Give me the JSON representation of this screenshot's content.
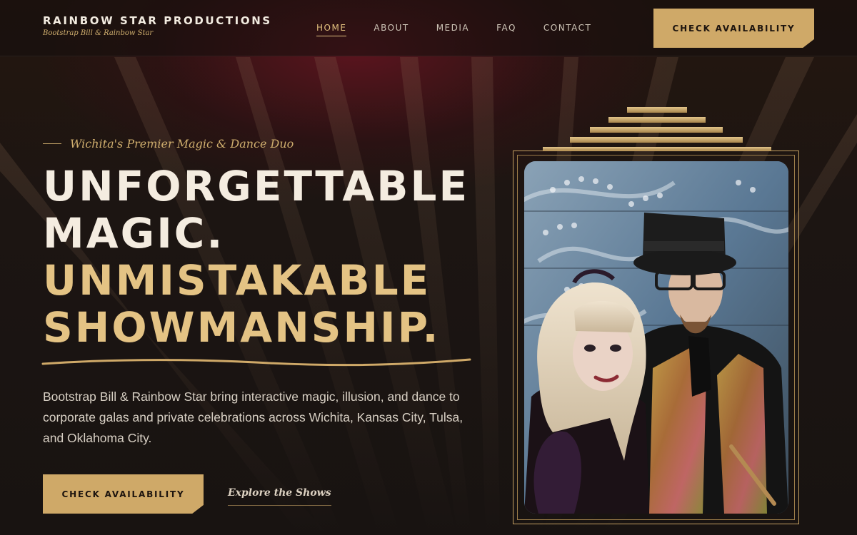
{
  "header": {
    "brand_name": "RAINBOW STAR PRODUCTIONS",
    "brand_subtitle": "Bootstrap Bill & Rainbow Star",
    "nav": [
      {
        "label": "HOME",
        "active": true
      },
      {
        "label": "ABOUT",
        "active": false
      },
      {
        "label": "MEDIA",
        "active": false
      },
      {
        "label": "FAQ",
        "active": false
      },
      {
        "label": "CONTACT",
        "active": false
      }
    ],
    "cta_label": "CHECK AVAILABILITY"
  },
  "hero": {
    "tagline": "Wichita's Premier Magic & Dance Duo",
    "headline_line1": "UNFORGETTABLE",
    "headline_line2": "MAGIC.",
    "headline_line3": "UNMISTAKABLE",
    "headline_line4": "SHOWMANSHIP.",
    "description": "Bootstrap Bill & Rainbow Star bring interactive magic, illusion, and dance to corporate galas and private celebrations across Wichita, Kansas City, Tulsa, and Oklahoma City.",
    "primary_cta": "CHECK AVAILABILITY",
    "secondary_cta": "Explore the Shows"
  },
  "colors": {
    "gold": "#cfa968",
    "gold_light": "#e4c384",
    "background": "#1a1412",
    "crimson_glow": "#6e1423"
  }
}
